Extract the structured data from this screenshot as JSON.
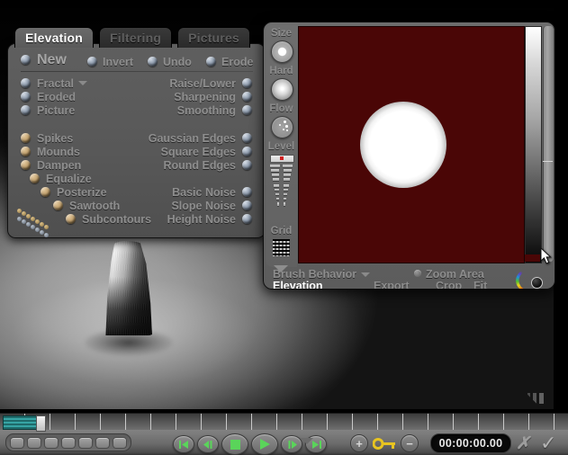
{
  "tabs": [
    {
      "label": "Elevation",
      "active": true
    },
    {
      "label": "Filtering",
      "active": false
    },
    {
      "label": "Pictures",
      "active": false
    }
  ],
  "tool_panel": {
    "top_actions": [
      {
        "label": "New",
        "bead": "blue"
      },
      {
        "label": "Invert",
        "bead": "blue"
      },
      {
        "label": "Undo",
        "bead": "blue"
      },
      {
        "label": "Erode",
        "bead": "blue"
      }
    ],
    "left_column": [
      {
        "label": "Fractal",
        "bead": "blue",
        "caret": true
      },
      {
        "label": "Eroded",
        "bead": "blue",
        "caret": false
      },
      {
        "label": "Picture",
        "bead": "blue",
        "caret": false
      }
    ],
    "right_column": [
      {
        "label": "Raise/Lower",
        "bead": "blue"
      },
      {
        "label": "Sharpening",
        "bead": "blue"
      },
      {
        "label": "Smoothing",
        "bead": "blue"
      }
    ],
    "left_column2": [
      {
        "label": "Spikes",
        "bead": "tan",
        "indent": 0
      },
      {
        "label": "Mounds",
        "bead": "tan",
        "indent": 0
      },
      {
        "label": "Dampen",
        "bead": "tan",
        "indent": 0
      },
      {
        "label": "Equalize",
        "bead": "tan",
        "indent": 10
      },
      {
        "label": "Posterize",
        "bead": "tan",
        "indent": 22
      },
      {
        "label": "Sawtooth",
        "bead": "tan",
        "indent": 36
      },
      {
        "label": "Subcontours",
        "bead": "tan",
        "indent": 50
      }
    ],
    "right_column2": [
      {
        "label": "Gaussian Edges",
        "bead": "blue"
      },
      {
        "label": "Square Edges",
        "bead": "blue"
      },
      {
        "label": "Round Edges",
        "bead": "blue"
      },
      {
        "label": "Basic Noise",
        "bead": "blue"
      },
      {
        "label": "Slope Noise",
        "bead": "blue"
      },
      {
        "label": "Height Noise",
        "bead": "blue"
      }
    ]
  },
  "brush_window": {
    "rail": [
      {
        "label": "Size",
        "icon": "brush-size-knob"
      },
      {
        "label": "Hard",
        "icon": "brush-hardness-knob"
      },
      {
        "label": "Flow",
        "icon": "brush-flow-knob"
      },
      {
        "label": "Level",
        "icon": "brush-level-slider"
      },
      {
        "label": "Grid",
        "icon": "grid-icon"
      }
    ],
    "preview_bg_color": "#4a0606",
    "footer": {
      "behavior_label": "Brush Behavior",
      "zoom_area_label": "Zoom Area",
      "mode_label": "Elevation",
      "export_label": "Export",
      "crop_label": "Crop",
      "fit_label": "Fit"
    }
  },
  "bottom_bar": {
    "timecode": "00:00:00.00",
    "small_buttons_count": 7,
    "transport": [
      {
        "name": "go-to-start-button",
        "glyph": "start"
      },
      {
        "name": "step-back-button",
        "glyph": "stepback"
      },
      {
        "name": "stop-button",
        "glyph": "stop"
      },
      {
        "name": "play-button",
        "glyph": "play"
      },
      {
        "name": "step-forward-button",
        "glyph": "stepfwd"
      },
      {
        "name": "go-to-end-button",
        "glyph": "end"
      }
    ],
    "add_key_label": "+",
    "remove_key_label": "−",
    "cancel_label": "✗",
    "confirm_label": "✓"
  },
  "colors": {
    "panel_bg": "#585858",
    "panel_text": "#8e8e8e",
    "accent_red": "#4a0606",
    "key_yellow": "#e8c420",
    "playhead_teal": "#36a4a4"
  }
}
